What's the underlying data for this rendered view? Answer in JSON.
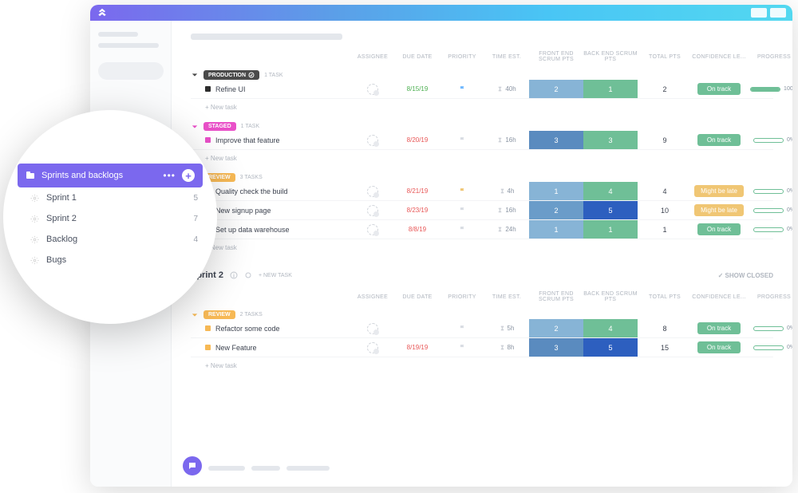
{
  "sidebar_popout": {
    "header": "Sprints and backlogs",
    "items": [
      {
        "label": "Sprint 1",
        "count": "5"
      },
      {
        "label": "Sprint 2",
        "count": "7"
      },
      {
        "label": "Backlog",
        "count": "4"
      },
      {
        "label": "Bugs",
        "count": ""
      }
    ]
  },
  "columns": {
    "assignee": "ASSIGNEE",
    "due": "DUE DATE",
    "priority": "PRIORITY",
    "time": "TIME EST.",
    "fe": "FRONT END SCRUM PTS",
    "be": "BACK END SCRUM PTS",
    "total": "TOTAL PTS",
    "conf": "CONFIDENCE LE...",
    "prog": "PROGRESS"
  },
  "new_task_label": "+ New task",
  "show_closed": "SHOW CLOSED",
  "groups": [
    {
      "status": "PRODUCTION",
      "status_class": "pill-prod",
      "chev": "#4a4a4a",
      "task_count": "1 TASK",
      "tasks": [
        {
          "sq": "#2d2d2d",
          "title": "Refine UI",
          "due": "8/15/19",
          "due_cls": "due-g",
          "flag": "#6fb8ff",
          "time": "40h",
          "fe": "2",
          "fe_bg": "#87b4d6",
          "be": "1",
          "be_bg": "#6fbf97",
          "total": "2",
          "conf": "On track",
          "conf_cls": "conf-ok",
          "prog": 100
        }
      ]
    },
    {
      "status": "STAGED",
      "status_class": "pill-staged",
      "chev": "#e950c8",
      "task_count": "1 TASK",
      "tasks": [
        {
          "sq": "#e950c8",
          "title": "Improve that feature",
          "due": "8/20/19",
          "due_cls": "due-r",
          "flag": "#d8dce2",
          "time": "16h",
          "fe": "3",
          "fe_bg": "#5a8bbf",
          "be": "3",
          "be_bg": "#6fbf97",
          "total": "9",
          "conf": "On track",
          "conf_cls": "conf-ok",
          "prog": 0
        }
      ]
    },
    {
      "status": "REVIEW",
      "status_class": "pill-review",
      "chev": "#f7b955",
      "task_count": "3 TASKS",
      "tasks": [
        {
          "sq": "#f7b955",
          "title": "Quality check the build",
          "due": "8/21/19",
          "due_cls": "due-r",
          "flag": "#f0c674",
          "time": "4h",
          "fe": "1",
          "fe_bg": "#87b4d6",
          "be": "4",
          "be_bg": "#6fbf97",
          "total": "4",
          "conf": "Might be late",
          "conf_cls": "conf-late",
          "prog": 0
        },
        {
          "sq": "#f7b955",
          "title": "New signup page",
          "due": "8/23/19",
          "due_cls": "due-r",
          "flag": "#d8dce2",
          "time": "16h",
          "fe": "2",
          "fe_bg": "#6a9cc9",
          "be": "5",
          "be_bg": "#2d5fbf",
          "total": "10",
          "conf": "Might be late",
          "conf_cls": "conf-late",
          "prog": 0
        },
        {
          "sq": "#f7b955",
          "title": "Set up data warehouse",
          "due": "8/8/19",
          "due_cls": "due-r",
          "flag": "#d8dce2",
          "time": "24h",
          "fe": "1",
          "fe_bg": "#87b4d6",
          "be": "1",
          "be_bg": "#6fbf97",
          "total": "1",
          "conf": "On track",
          "conf_cls": "conf-ok",
          "prog": 0
        }
      ]
    }
  ],
  "sprint2": {
    "title": "Sprint 2",
    "tasks_sub": "+ NEW TASK",
    "groups": [
      {
        "status": "REVIEW",
        "status_class": "pill-review",
        "chev": "#f7b955",
        "task_count": "2 TASKS",
        "tasks": [
          {
            "sq": "#f7b955",
            "title": "Refactor some code",
            "due": "",
            "due_cls": "",
            "flag": "#d8dce2",
            "time": "5h",
            "fe": "2",
            "fe_bg": "#87b4d6",
            "be": "4",
            "be_bg": "#6fbf97",
            "total": "8",
            "conf": "On track",
            "conf_cls": "conf-ok",
            "prog": 0
          },
          {
            "sq": "#f7b955",
            "title": "New Feature",
            "due": "8/19/19",
            "due_cls": "due-r",
            "flag": "#d8dce2",
            "time": "8h",
            "fe": "3",
            "fe_bg": "#5a8bbf",
            "be": "5",
            "be_bg": "#2d5fbf",
            "total": "15",
            "conf": "On track",
            "conf_cls": "conf-ok",
            "prog": 0
          }
        ]
      }
    ]
  }
}
